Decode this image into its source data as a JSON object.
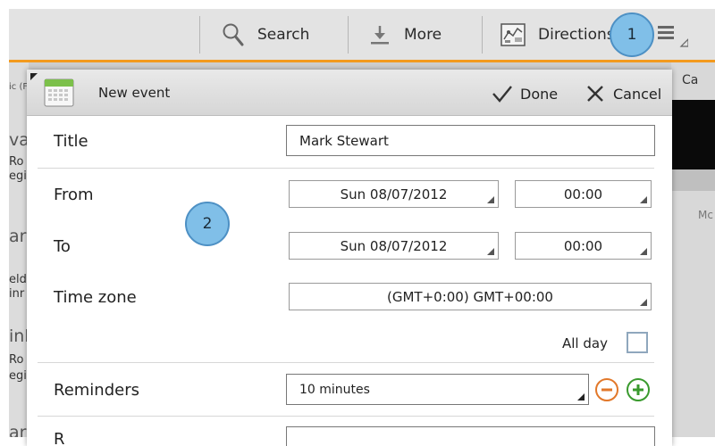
{
  "actionbar": {
    "search_label": "Search",
    "more_label": "More",
    "directions_label": "Directions"
  },
  "background": {
    "left_fragments": [
      "ic (F",
      "var",
      "Ro",
      "egis",
      "ark",
      "eld",
      "inr",
      "ink",
      "Ro",
      "egis",
      "ark"
    ],
    "right_calendar_label": "Ca",
    "right_col_label": "Mc"
  },
  "dialog": {
    "title": "New event",
    "done_label": "Done",
    "cancel_label": "Cancel",
    "title_label": "Title",
    "title_value": "Mark Stewart",
    "from_label": "From",
    "from_date": "Sun 08/07/2012",
    "from_time": "00:00",
    "to_label": "To",
    "to_date": "Sun 08/07/2012",
    "to_time": "00:00",
    "timezone_label": "Time zone",
    "timezone_value": "(GMT+0:00) GMT+00:00",
    "allday_label": "All day",
    "allday_checked": false,
    "reminders_label": "Reminders",
    "reminder_value": "10 minutes",
    "next_row_partial": "R"
  },
  "annotations": {
    "badge1": "1",
    "badge2": "2"
  },
  "colors": {
    "accent": "#f39a1e",
    "badge": "#80bfe8",
    "remove_button": "#e2782a",
    "add_button": "#3a9a2e"
  }
}
